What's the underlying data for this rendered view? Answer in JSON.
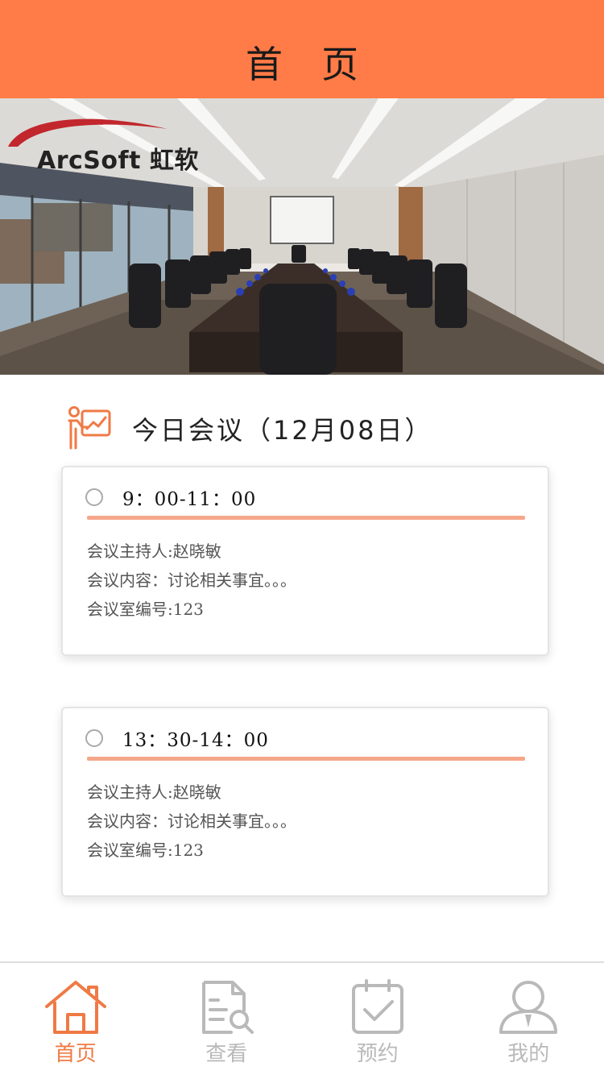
{
  "header": {
    "title": "首页"
  },
  "banner": {
    "logo_text": "ArcSoft 虹软"
  },
  "section": {
    "title": "今日会议（12月08日）"
  },
  "meetings": [
    {
      "time": "9：00-11：00",
      "host": "会议主持人:赵晓敏",
      "content": "会议内容：讨论相关事宜。。。",
      "room": "会议室编号:123"
    },
    {
      "time": "13：30-14：00",
      "host": "会议主持人:赵晓敏",
      "content": "会议内容：讨论相关事宜。。。",
      "room": "会议室编号:123"
    }
  ],
  "tabbar": {
    "items": [
      {
        "label": "首页",
        "icon": "home-icon",
        "active": true
      },
      {
        "label": "查看",
        "icon": "document-search-icon",
        "active": false
      },
      {
        "label": "预约",
        "icon": "calendar-check-icon",
        "active": false
      },
      {
        "label": "我的",
        "icon": "user-icon",
        "active": false
      }
    ]
  },
  "colors": {
    "accent": "#ff7b47",
    "active_tab": "#ef7a45",
    "inactive_tab": "#b9b9b9",
    "divider": "#f5a78a"
  }
}
